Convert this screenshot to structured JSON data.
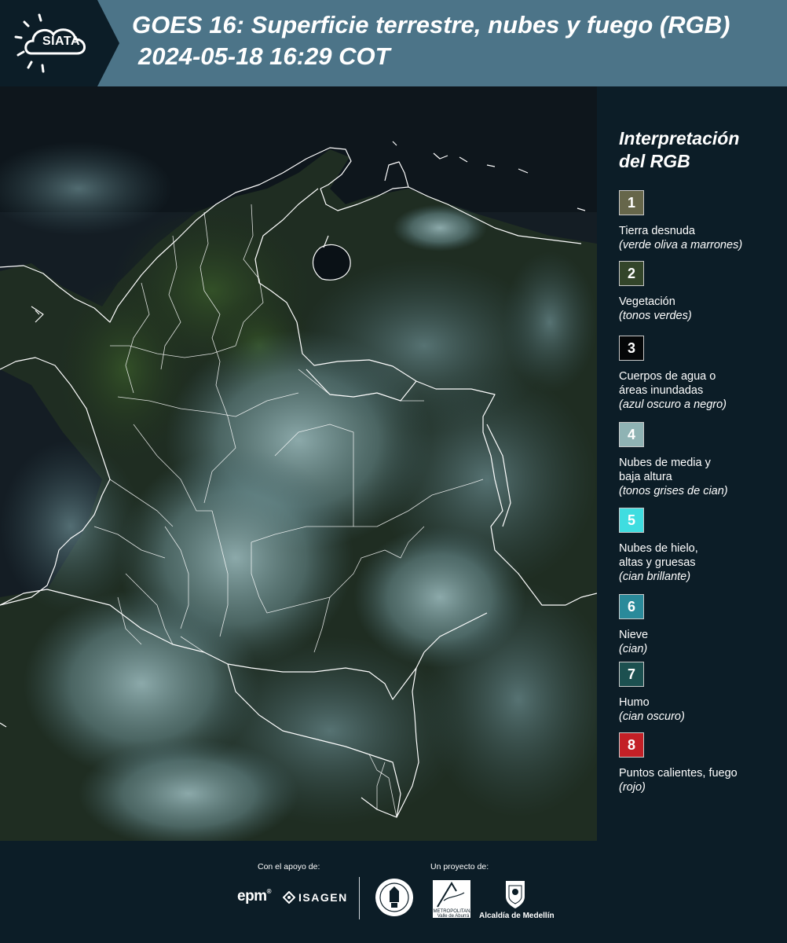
{
  "header": {
    "logo_text": "SIATA",
    "title_line1": "GOES 16: Superficie terrestre, nubes y fuego (RGB)",
    "title_line2": "2024-05-18 16:29 COT"
  },
  "legend": {
    "title_line1": "Interpretación",
    "title_line2": "del RGB",
    "items": [
      {
        "num": "1",
        "label_lines": [
          "Tierra desnuda"
        ],
        "sub": "(verde oliva a marrones)",
        "color": "#66664a",
        "text_color": "#ffffff"
      },
      {
        "num": "2",
        "label_lines": [
          "Vegetación"
        ],
        "sub": "(tonos verdes)",
        "color": "#33452a",
        "text_color": "#ffffff"
      },
      {
        "num": "3",
        "label_lines": [
          "Cuerpos de agua o",
          "áreas inundadas"
        ],
        "sub": "(azul oscuro a negro)",
        "color": "#050708",
        "text_color": "#ffffff"
      },
      {
        "num": "4",
        "label_lines": [
          "Nubes de media y",
          "baja altura"
        ],
        "sub": "(tonos grises de cian)",
        "color": "#8fb3b4",
        "text_color": "#ffffff"
      },
      {
        "num": "5",
        "label_lines": [
          "Nubes de hielo,",
          "altas y gruesas"
        ],
        "sub": "(cian brillante)",
        "color": "#3fdde0",
        "text_color": "#ffffff"
      },
      {
        "num": "6",
        "label_lines": [
          "Nieve"
        ],
        "sub": "(cian)",
        "color": "#2a8a9a",
        "text_color": "#ffffff"
      },
      {
        "num": "7",
        "label_lines": [
          "Humo"
        ],
        "sub": "(cian oscuro)",
        "color": "#1c5050",
        "text_color": "#ffffff"
      },
      {
        "num": "8",
        "label_lines": [
          "Puntos calientes, fuego"
        ],
        "sub": "(rojo)",
        "color": "#c32026",
        "text_color": "#ffffff"
      }
    ]
  },
  "footer": {
    "support_label": "Con el apoyo de:",
    "project_label": "Un proyecto de:",
    "epm": "epm",
    "isagen": "ISAGEN",
    "amva_name": "Área",
    "amva_sub": "METROPOLITANA",
    "amva_sub2": "Valle de Aburrá",
    "alcaldia": "Alcaldía de Medellín"
  },
  "colors": {
    "header_bg": "#4c7488",
    "panel_bg": "#0c1d27",
    "land": "#28381f",
    "water": "#0b1318",
    "cloud": "#7d9ea2",
    "border": "#ffffff"
  }
}
